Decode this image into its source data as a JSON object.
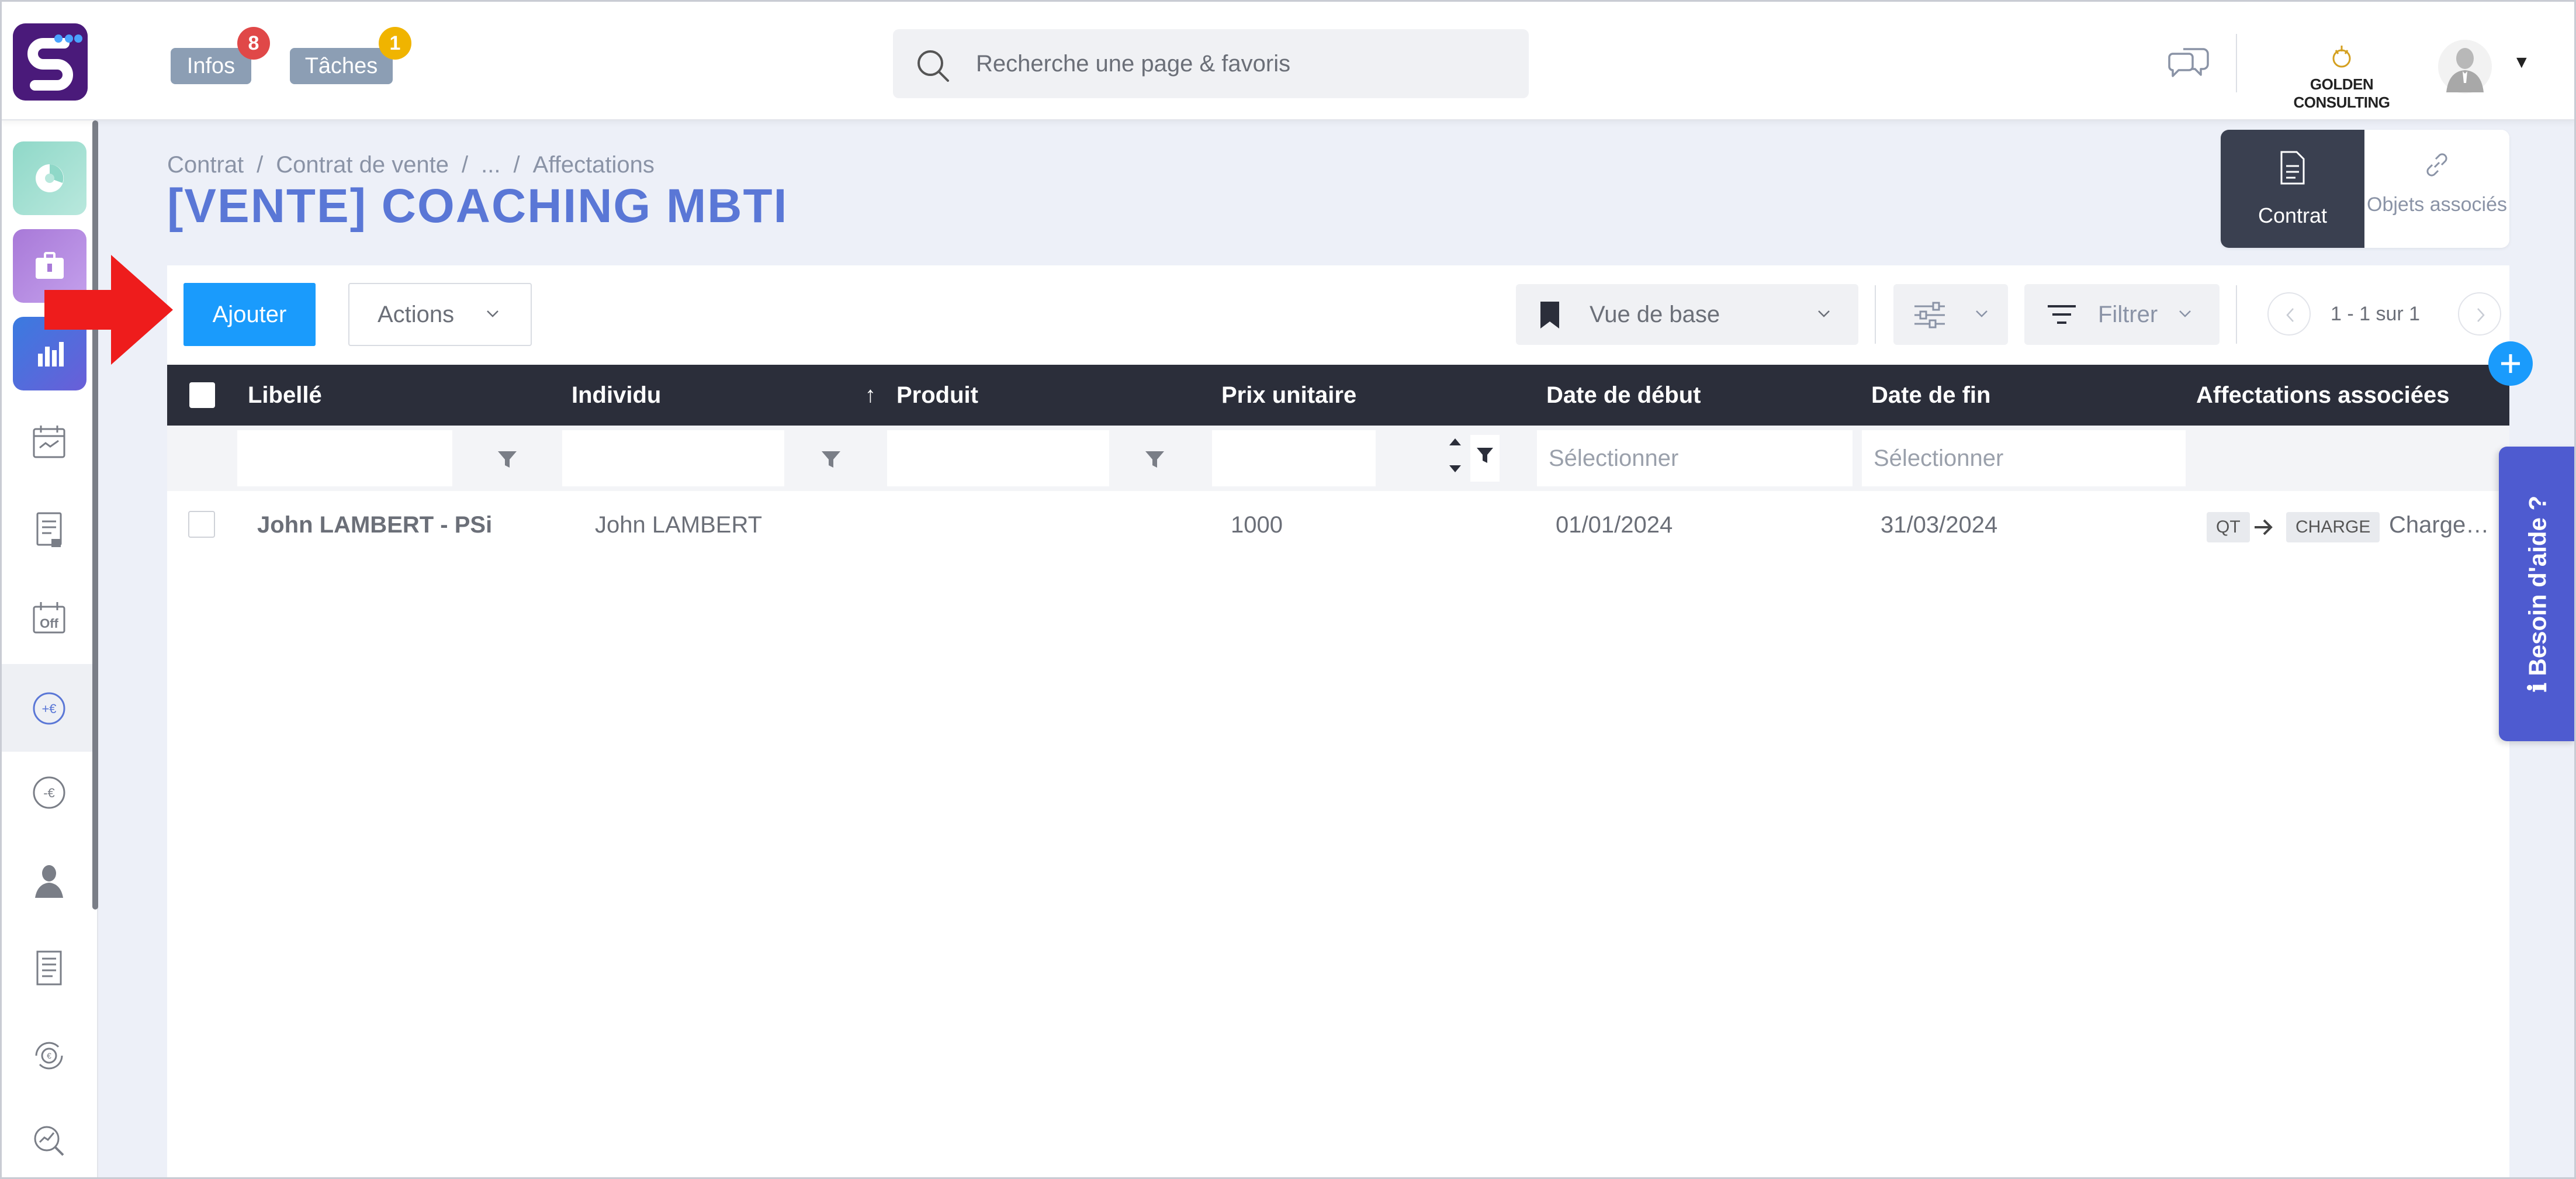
{
  "header": {
    "infos": {
      "label": "Infos",
      "count": "8"
    },
    "taches": {
      "label": "Tâches",
      "count": "1"
    },
    "search": {
      "placeholder": "Recherche une page & favoris"
    },
    "company": "GOLDEN CONSULTING",
    "colors": {
      "infos_badge": "#e04848",
      "taches_badge": "#f0b400",
      "pill": "#8c9eb4"
    }
  },
  "sidebar": {
    "items": [
      {
        "name": "dashboard",
        "icon": "pie-chart-icon"
      },
      {
        "name": "briefcase",
        "icon": "briefcase-icon"
      },
      {
        "name": "reports",
        "icon": "bar-chart-icon"
      },
      {
        "name": "planning",
        "icon": "calendar-icon"
      },
      {
        "name": "documents",
        "icon": "document-icon"
      },
      {
        "name": "off",
        "icon": "off-calendar-icon"
      },
      {
        "name": "revenus",
        "icon": "plus-euro-icon"
      },
      {
        "name": "charges",
        "icon": "minus-euro-icon"
      },
      {
        "name": "personnes",
        "icon": "person-icon"
      },
      {
        "name": "factures",
        "icon": "invoice-icon"
      },
      {
        "name": "tresorerie",
        "icon": "euro-cycle-icon"
      },
      {
        "name": "analyse",
        "icon": "analytics-icon"
      }
    ]
  },
  "breadcrumb": {
    "items": [
      "Contrat",
      "Contrat de vente",
      "...",
      "Affectations"
    ],
    "sep": "/"
  },
  "page": {
    "title": "[VENTE] COACHING MBTI"
  },
  "tabs": {
    "contrat": "Contrat",
    "objets": "Objets associés"
  },
  "toolbar": {
    "add": "Ajouter",
    "actions": "Actions",
    "view": "Vue de base",
    "filter": "Filtrer",
    "pager": "1 - 1 sur 1"
  },
  "table": {
    "columns": [
      "Libellé",
      "Individu",
      "Produit",
      "Prix unitaire",
      "Date de début",
      "Date de fin",
      "Affectations associées"
    ],
    "filter_placeholders": {
      "debut": "Sélectionner",
      "fin": "Sélectionner"
    },
    "rows": [
      {
        "libelle": "John LAMBERT - PSi",
        "individu": "John LAMBERT",
        "produit": "",
        "prix": "1000",
        "debut": "01/01/2024",
        "fin": "31/03/2024",
        "affectations": {
          "from": "QT",
          "to": "CHARGE",
          "label": "Charge…"
        }
      }
    ]
  },
  "help": {
    "label": "Besoin d'aide ?"
  }
}
